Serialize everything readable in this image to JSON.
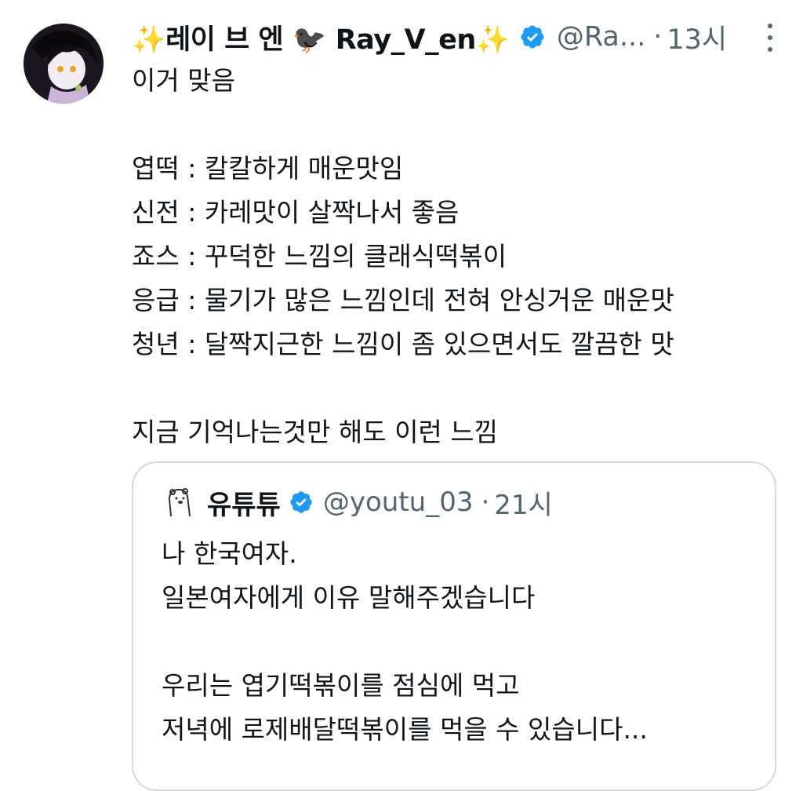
{
  "tweet": {
    "display_name": "✨레이 브 엔 🐦‍⬛ Ray_V_en✨",
    "handle": "@Ra...",
    "separator": "·",
    "time": "13시",
    "text_lines": [
      "이거 맞음",
      "",
      "엽떡 : 칼칼하게 매운맛임",
      "신전 : 카레맛이 살짝나서 좋음",
      "죠스 : 꾸덕한 느낌의 클래식떡볶이",
      "응급 : 물기가 많은 느낌인데 전혀 안싱거운 매운맛",
      "청년 : 달짝지근한 느낌이 좀 있으면서도 깔끔한 맛",
      "",
      "지금 기억나는것만 해도 이런 느낌"
    ]
  },
  "quote": {
    "display_name": "유튜튜",
    "handle": "@youtu_03",
    "separator": "·",
    "time": "21시",
    "text_lines": [
      "나 한국여자.",
      "일본여자에게 이유 말해주겠습니다",
      "",
      "우리는 엽기떡볶이를 점심에 먹고",
      "저녁에 로제배달떡볶이를 먹을 수 있습니다..."
    ]
  },
  "icons": {
    "verified_color": "#1d9bf0",
    "more": "more-vertical-icon"
  }
}
